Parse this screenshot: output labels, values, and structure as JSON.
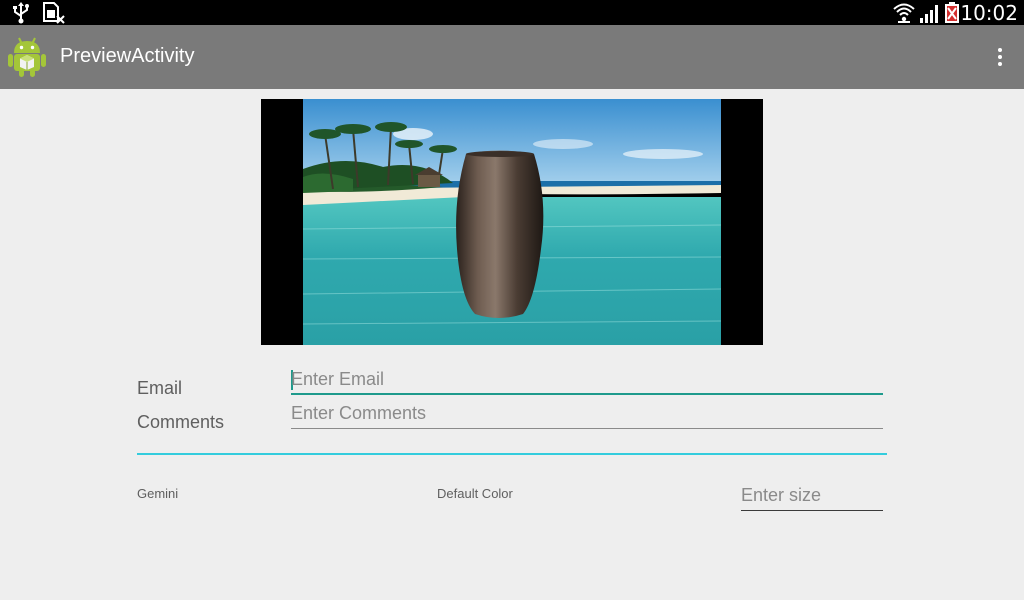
{
  "status_bar": {
    "time": "10:02",
    "icons": [
      "usb-icon",
      "sim-error-icon",
      "wifi-icon",
      "signal-icon",
      "battery-icon"
    ]
  },
  "action_bar": {
    "title": "PreviewActivity",
    "app_icon": "android-robot-icon",
    "menu_icon": "overflow-menu-icon"
  },
  "form": {
    "email_label": "Email",
    "email_placeholder": "Enter Email",
    "comments_label": "Comments",
    "comments_placeholder": "Enter Comments",
    "font_label": "Gemini",
    "color_label": "Default Color",
    "size_placeholder": "Enter size"
  },
  "colors": {
    "action_bar": "#7a7a7a",
    "accent": "#1e9a8c",
    "divider": "#33ccdd",
    "background": "#eeeeee"
  }
}
